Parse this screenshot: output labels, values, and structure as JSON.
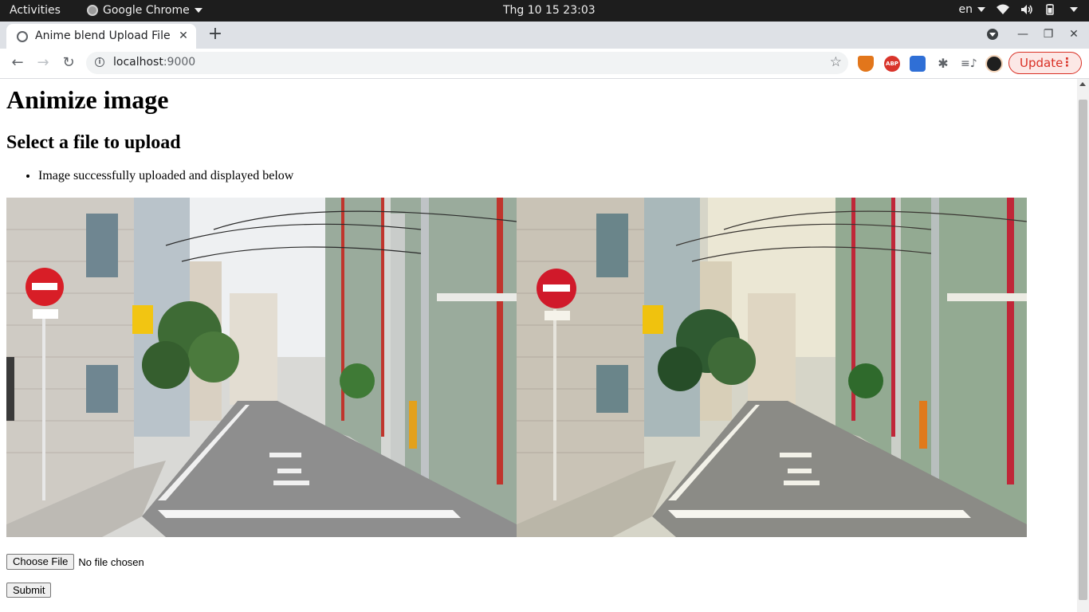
{
  "topbar": {
    "activities": "Activities",
    "app_menu": "Google Chrome",
    "clock": "Thg 10 15  23:03",
    "lang": "en"
  },
  "browser": {
    "tab_title": "Anime blend Upload File",
    "url_host": "localhost",
    "url_port": ":9000",
    "update_label": "Update"
  },
  "page": {
    "heading": "Animize image",
    "subheading": "Select a file to upload",
    "messages": [
      "Image successfully uploaded and displayed below"
    ],
    "choose_file_label": "Choose File",
    "file_status": "No file chosen",
    "submit_label": "Submit"
  },
  "colors": {
    "accent_update": "#d93025",
    "tab_strip": "#dee1e6",
    "topbar": "#1d1d1d"
  },
  "icons": {
    "info": "info-icon",
    "star": "bookmark-star-icon",
    "puzzle": "extensions-icon"
  }
}
